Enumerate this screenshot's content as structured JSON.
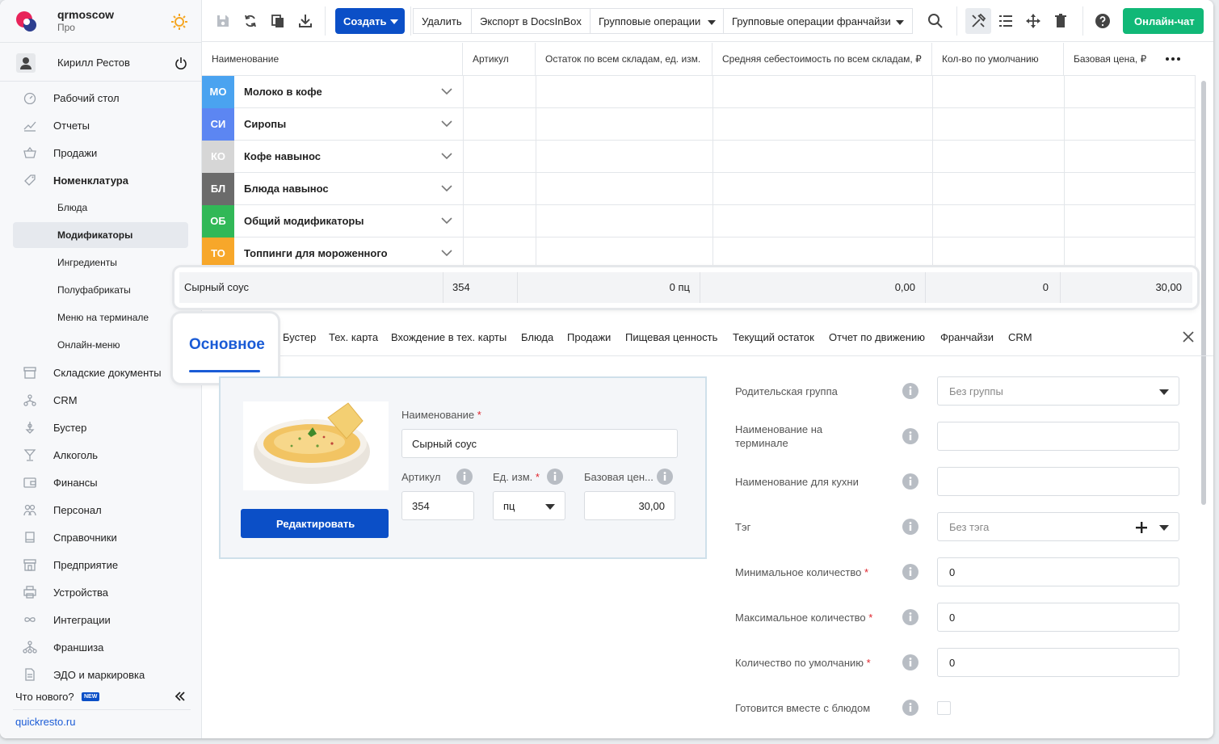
{
  "brand": {
    "name": "qrmoscow",
    "plan": "Про"
  },
  "user": {
    "name": "Кирилл Рестов"
  },
  "sidebar": {
    "items": [
      {
        "label": "Рабочий стол",
        "icon": "dashboard-icon"
      },
      {
        "label": "Отчеты",
        "icon": "chart-icon"
      },
      {
        "label": "Продажи",
        "icon": "basket-icon"
      },
      {
        "label": "Номенклатура",
        "icon": "tag-icon"
      },
      {
        "label": "Блюда"
      },
      {
        "label": "Модификаторы"
      },
      {
        "label": "Ингредиенты"
      },
      {
        "label": "Полуфабрикаты"
      },
      {
        "label": "Меню на терминале"
      },
      {
        "label": "Онлайн-меню"
      },
      {
        "label": "Складские документы",
        "icon": "warehouse-icon"
      },
      {
        "label": "CRM",
        "icon": "crm-icon"
      },
      {
        "label": "Бустер",
        "icon": "booster-icon"
      },
      {
        "label": "Алкоголь",
        "icon": "glass-icon"
      },
      {
        "label": "Финансы",
        "icon": "wallet-icon"
      },
      {
        "label": "Персонал",
        "icon": "staff-icon"
      },
      {
        "label": "Справочники",
        "icon": "book-icon"
      },
      {
        "label": "Предприятие",
        "icon": "store-icon"
      },
      {
        "label": "Устройства",
        "icon": "printer-icon"
      },
      {
        "label": "Интеграции",
        "icon": "infinity-icon"
      },
      {
        "label": "Франшиза",
        "icon": "network-icon"
      },
      {
        "label": "ЭДО и маркировка",
        "icon": "document-icon"
      }
    ],
    "whats_new": "Что нового?",
    "new_badge": "NEW",
    "footer_link": "quickresto.ru"
  },
  "toolbar": {
    "create": "Создать",
    "delete": "Удалить",
    "export": "Экспорт в DocsInBox",
    "group_ops": "Групповые операции",
    "group_ops_franchise": "Групповые операции франчайзи",
    "chat": "Онлайн-чат"
  },
  "table": {
    "columns": [
      "Наименование",
      "Артикул",
      "Остаток по всем складам, ед. изм.",
      "Средняя себестоимость по всем складам, ₽",
      "Кол-во по умолчанию",
      "Базовая цена, ₽"
    ],
    "groups": [
      {
        "abbr": "МО",
        "name": "Молоко в кофе",
        "color": "#4aa3f0"
      },
      {
        "abbr": "СИ",
        "name": "Сиропы",
        "color": "#5c86f2"
      },
      {
        "abbr": "КО",
        "name": "Кофе навынос",
        "color": "#d6d6d6"
      },
      {
        "abbr": "БЛ",
        "name": "Блюда навынос",
        "color": "#6b6b6b"
      },
      {
        "abbr": "ОБ",
        "name": "Общий модификаторы",
        "color": "#31b857"
      },
      {
        "abbr": "ТО",
        "name": "Топпинги для мороженного",
        "color": "#f7a72a"
      }
    ],
    "selected_row": {
      "name": "Сырный соус",
      "article": "354",
      "stock": "0 пц",
      "avg_cost": "0,00",
      "default_qty": "0",
      "base_price": "30,00"
    }
  },
  "tabs": {
    "active": "Основное",
    "items": [
      "Бустер",
      "Тех. карта",
      "Вхождение в тех. карты",
      "Блюда",
      "Продажи",
      "Пищевая ценность",
      "Текущий остаток",
      "Отчет по движению",
      "Франчайзи",
      "CRM"
    ]
  },
  "card": {
    "name_label": "Наименование",
    "name_value": "Сырный соус",
    "article_label": "Артикул",
    "article_value": "354",
    "unit_label": "Ед. изм.",
    "unit_value": "пц",
    "price_label": "Базовая цен...",
    "price_value": "30,00",
    "edit_button": "Редактировать",
    "required_mark": "*"
  },
  "form": {
    "parent_group_label": "Родительская группа",
    "parent_group_value": "Без группы",
    "terminal_name_label_1": "Наименование на",
    "terminal_name_label_2": "терминале",
    "kitchen_name_label": "Наименование для кухни",
    "tag_label": "Тэг",
    "tag_value": "Без тэга",
    "min_qty_label": "Минимальное количество",
    "min_qty_value": "0",
    "max_qty_label": "Максимальное количество",
    "max_qty_value": "0",
    "default_qty_label": "Количество по умолчанию",
    "default_qty_value": "0",
    "cooked_with_dish_label": "Готовится вместе с блюдом",
    "required_mark": "*"
  }
}
